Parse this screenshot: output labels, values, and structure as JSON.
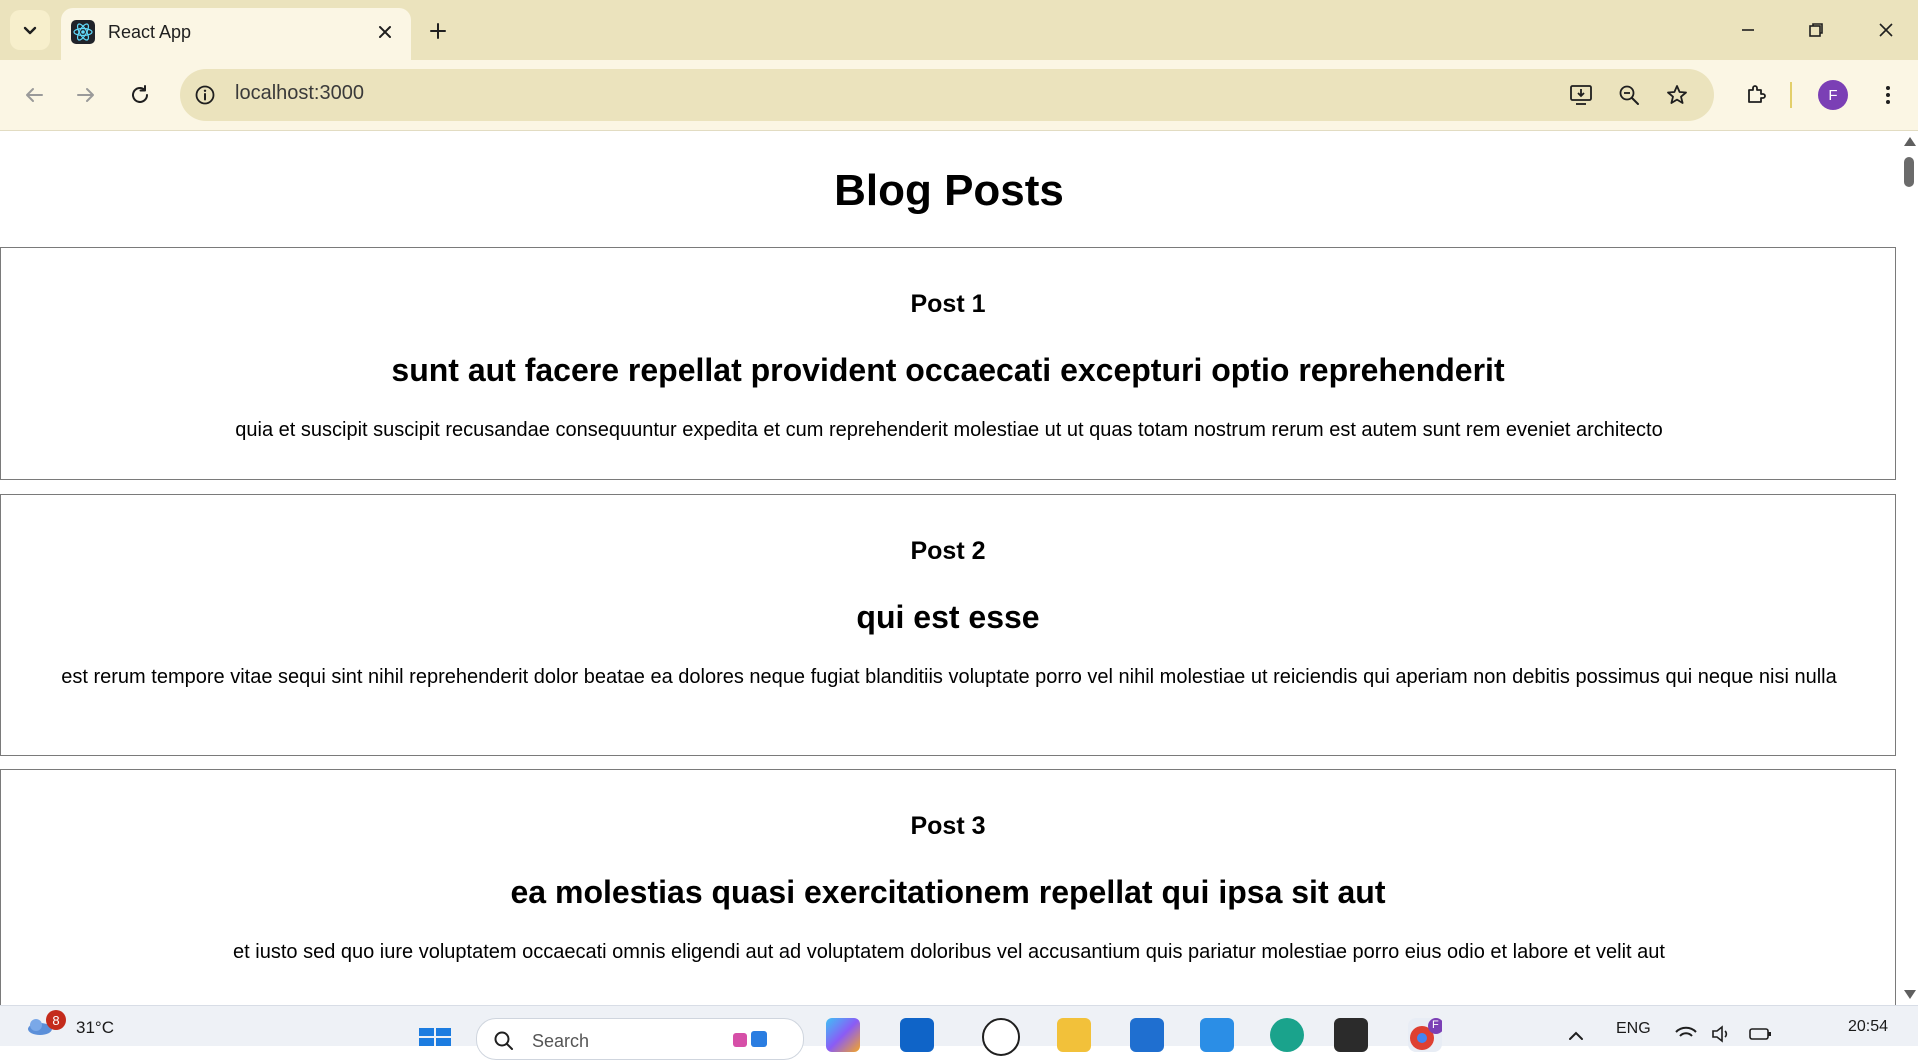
{
  "browser": {
    "tab_title": "React App",
    "url": "localhost:3000",
    "profile_initial": "F"
  },
  "page": {
    "title": "Blog Posts",
    "posts": [
      {
        "label": "Post 1",
        "title": "sunt aut facere repellat provident occaecati excepturi optio reprehenderit",
        "body": "quia et suscipit suscipit recusandae consequuntur expedita et cum reprehenderit molestiae ut ut quas totam nostrum rerum est autem sunt rem eveniet architecto"
      },
      {
        "label": "Post 2",
        "title": "qui est esse",
        "body": "est rerum tempore vitae sequi sint nihil reprehenderit dolor beatae ea dolores neque fugiat blanditiis voluptate porro vel nihil molestiae ut reiciendis qui aperiam non debitis possimus qui neque nisi nulla"
      },
      {
        "label": "Post 3",
        "title": "ea molestias quasi exercitationem repellat qui ipsa sit aut",
        "body": "et iusto sed quo iure voluptatem occaecati omnis eligendi aut ad voluptatem doloribus vel accusantium quis pariatur molestiae porro eius odio et labore et velit aut"
      }
    ]
  },
  "taskbar": {
    "weather_badge": "8",
    "temperature": "31°C",
    "search_placeholder": "Search",
    "language": "ENG",
    "time": "20:54",
    "profile_initial": "F"
  },
  "colors": {
    "tabstrip": "#ebe3bd",
    "toolbar": "#fbf6e4",
    "avatar": "#7b3fb5",
    "post_border": "#7a7a7a"
  }
}
